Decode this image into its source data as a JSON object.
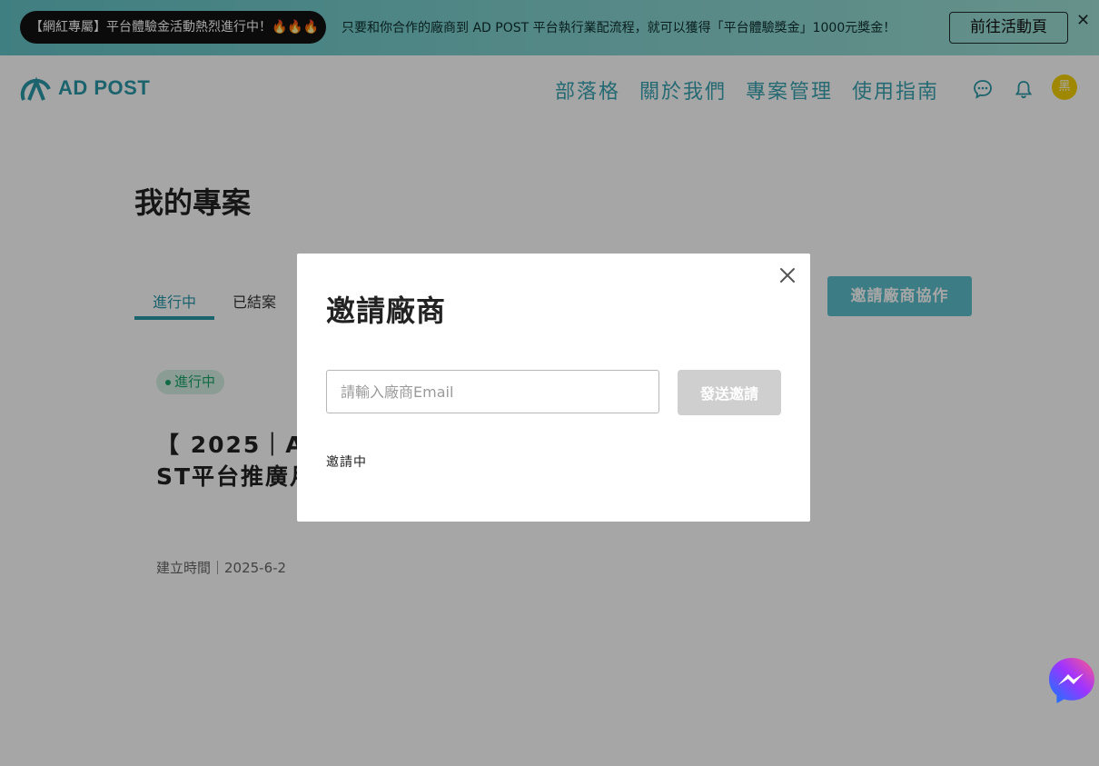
{
  "banner": {
    "pill_text": "【網紅專屬】平台體驗金活動熱烈進行中！🔥🔥🔥",
    "message": "只要和你合作的廠商到 AD POST 平台執行業配流程，就可以獲得「平台體驗獎金」1000元獎金！",
    "cta_label": "前往活動頁",
    "close_glyph": "✕"
  },
  "navbar": {
    "logo_text": "AD POST",
    "links": [
      "部落格",
      "關於我們",
      "專案管理",
      "使用指南"
    ],
    "avatar_text": "黑"
  },
  "page": {
    "title": "我的專案",
    "tabs": [
      {
        "label": "進行中",
        "active": true
      },
      {
        "label": "已結案",
        "active": false
      }
    ],
    "invite_button_label": "邀請廠商協作",
    "project": {
      "status": "進行中",
      "title": "【 2025｜AD POST平台推廣月】",
      "created": "建立時間｜2025-6-2"
    }
  },
  "modal": {
    "title": "邀請廠商",
    "email_placeholder": "請輸入廠商Email",
    "email_value": "",
    "send_label": "發送邀請",
    "pending_label": "邀請中"
  },
  "colors": {
    "brand": "#2a98a8",
    "accent_button": "#5cbfcb",
    "success": "#19a56a",
    "avatar": "#f4d200"
  }
}
